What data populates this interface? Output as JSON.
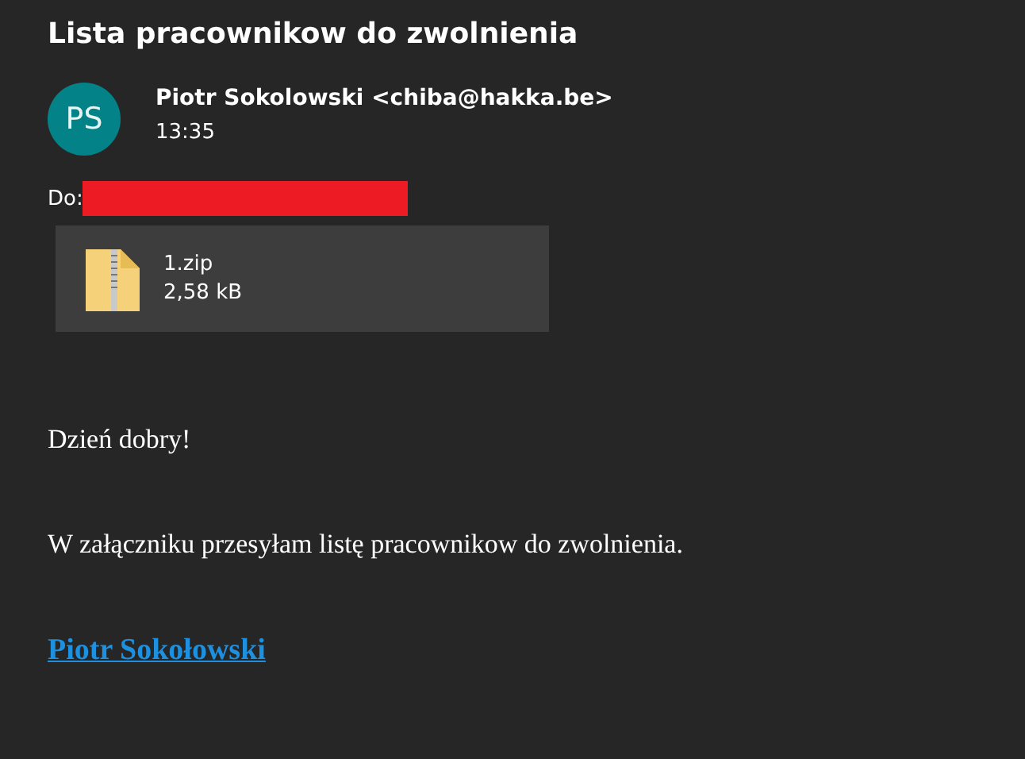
{
  "subject": "Lista pracownikow do zwolnienia",
  "sender": {
    "initials": "PS",
    "name": "Piotr Sokolowski <chiba@hakka.be>",
    "time": "13:35"
  },
  "recipients": {
    "label": "Do:"
  },
  "attachments": [
    {
      "name": "1.zip",
      "size": "2,58 kB"
    }
  ],
  "body": {
    "paragraphs": [
      "Dzień dobry!",
      "W załączniku przesyłam listę pracownikow do zwolnienia."
    ],
    "signature": "Piotr Sokołowski"
  }
}
